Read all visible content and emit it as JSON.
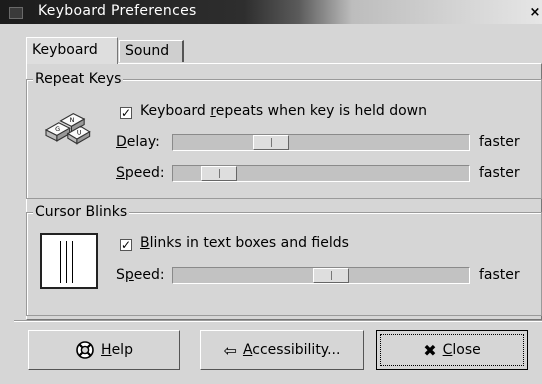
{
  "window": {
    "title": "Keyboard Preferences",
    "close_glyph": "×"
  },
  "tabs": [
    {
      "label": "Keyboard",
      "active": true
    },
    {
      "label": "Sound",
      "active": false
    }
  ],
  "repeat_keys": {
    "frame_label": "Repeat Keys",
    "checkbox": {
      "pre": "Keyboard ",
      "mnemonic": "r",
      "post": "epeats when key is held down",
      "checked": true
    },
    "delay": {
      "mnemonic": "D",
      "rest": "elay:",
      "max_label": "faster",
      "value_fraction": 0.32
    },
    "speed": {
      "mnemonic": "S",
      "rest": "peed:",
      "max_label": "faster",
      "value_fraction": 0.12
    }
  },
  "cursor_blinks": {
    "frame_label": "Cursor Blinks",
    "checkbox": {
      "mnemonic": "B",
      "rest": "links in text boxes and fields",
      "checked": true
    },
    "speed": {
      "pre": "S",
      "mnemonic": "p",
      "rest": "eed:",
      "max_label": "faster",
      "value_fraction": 0.53
    }
  },
  "buttons": {
    "help": {
      "mnemonic": "H",
      "rest": "elp",
      "icon": "help-lifebuoy-icon"
    },
    "accessibility": {
      "mnemonic": "A",
      "rest": "ccessibility...",
      "icon": "accessibility-icon"
    },
    "close": {
      "mnemonic": "C",
      "rest": "lose",
      "icon": "close-x-icon"
    }
  }
}
